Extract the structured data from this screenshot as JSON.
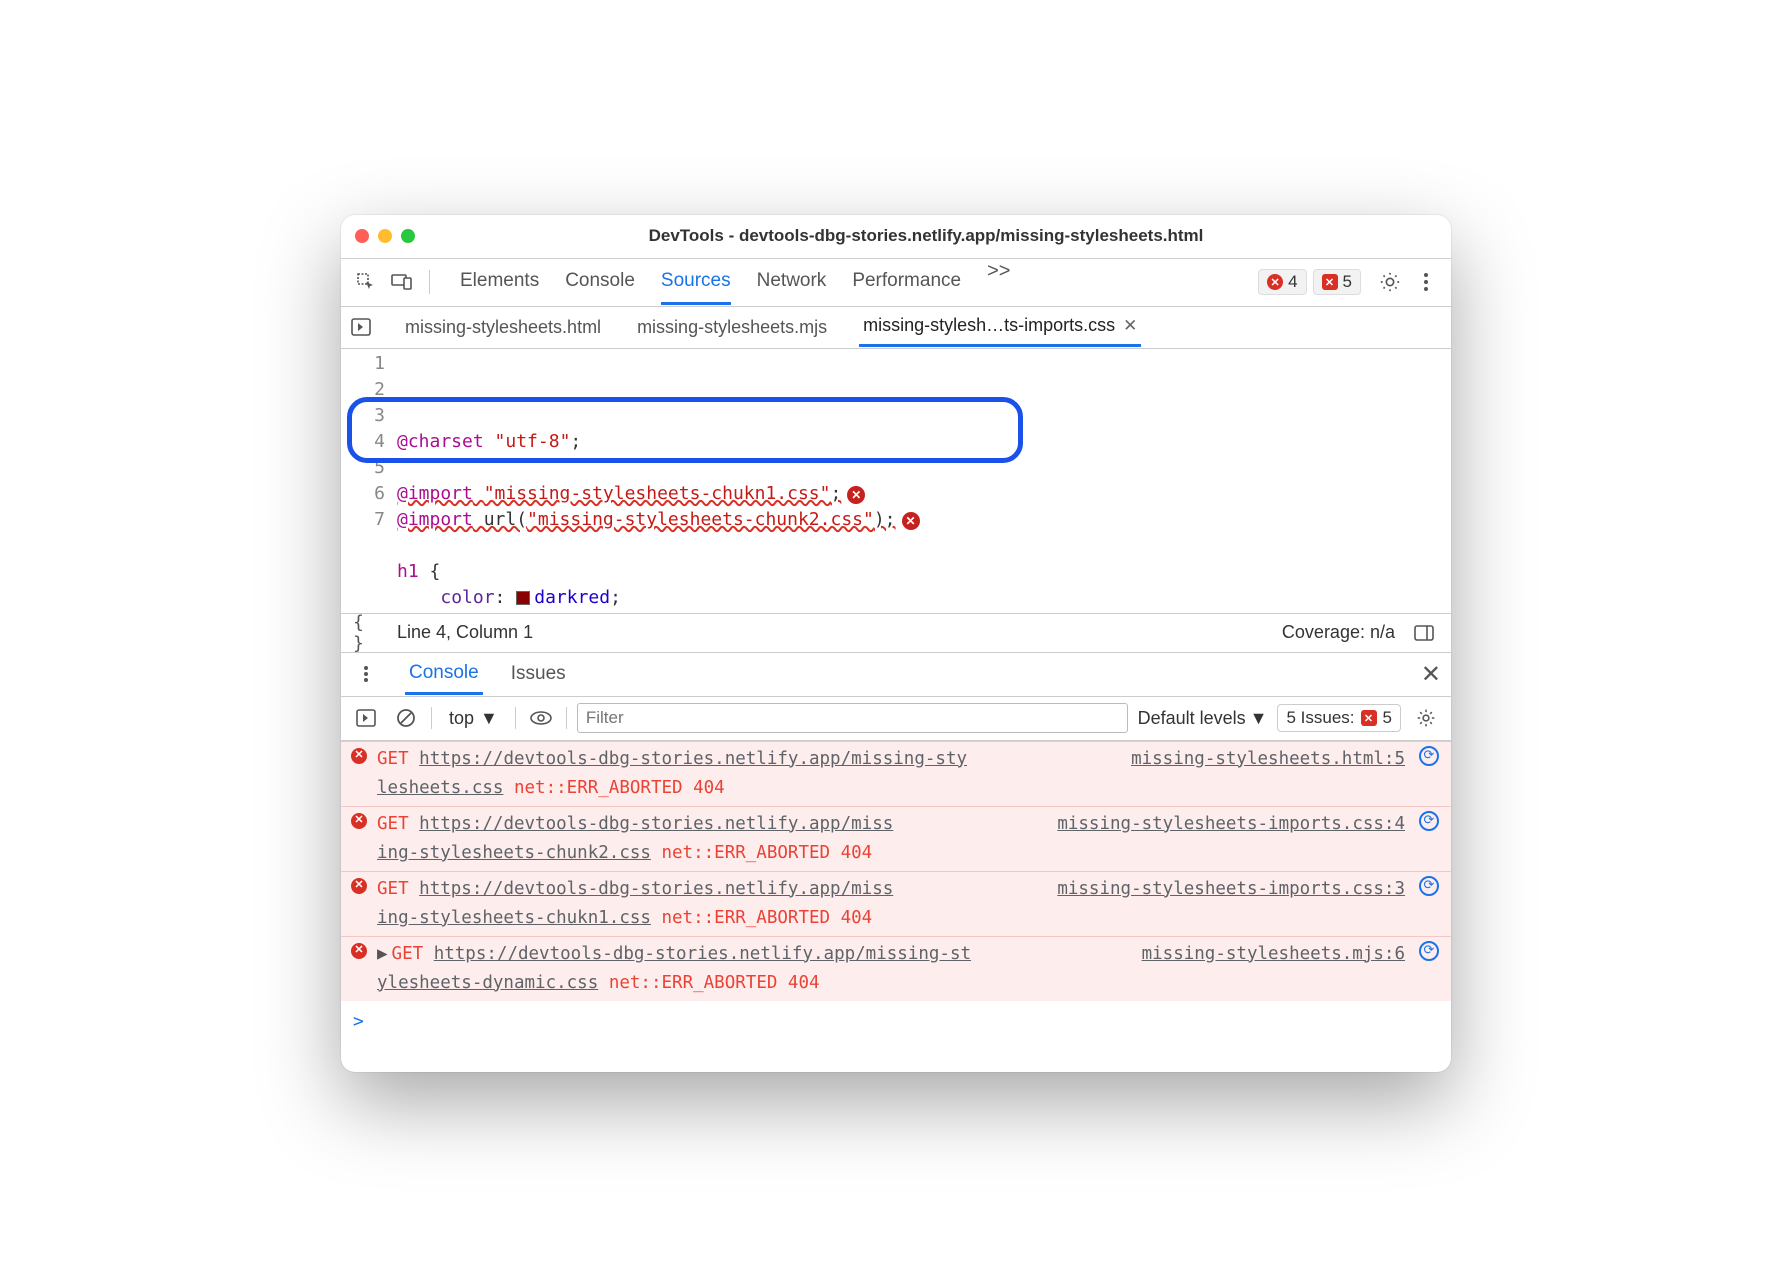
{
  "window": {
    "title": "DevTools - devtools-dbg-stories.netlify.app/missing-stylesheets.html"
  },
  "panels": {
    "items": [
      "Elements",
      "Console",
      "Sources",
      "Network",
      "Performance"
    ],
    "active": "Sources",
    "more": ">>"
  },
  "error_badges": {
    "round": "4",
    "square": "5"
  },
  "file_tabs": {
    "items": [
      {
        "label": "missing-stylesheets.html",
        "active": false
      },
      {
        "label": "missing-stylesheets.mjs",
        "active": false
      },
      {
        "label": "missing-stylesh…ts-imports.css",
        "active": true
      }
    ]
  },
  "editor": {
    "lines": [
      {
        "n": "1",
        "html": "<span class='k-at'>@charset</span> <span class='k-str'>\"utf-8\"</span>;"
      },
      {
        "n": "2",
        "html": ""
      },
      {
        "n": "3",
        "html": "<span class='k-at wavy'>@import</span><span class='wavy'> </span><span class='k-str wavy'>\"missing-stylesheets-chukn1.css\"</span><span class='wavy'>;</span><span class='inline-err'>✕</span>"
      },
      {
        "n": "4",
        "html": "<span class='k-at wavy'>@import</span><span class='wavy'> url(</span><span class='k-str wavy'>\"missing-stylesheets-chunk2.css\"</span><span class='wavy'>);</span><span class='inline-err'>✕</span>"
      },
      {
        "n": "5",
        "html": ""
      },
      {
        "n": "6",
        "html": "<span class='k-sel'>h1</span> {"
      },
      {
        "n": "7",
        "html": "    <span class='k-prop'>color</span>: <span class='swatch'></span><span class='k-val'>darkred</span>;"
      }
    ]
  },
  "status": {
    "cursor": "Line 4, Column 1",
    "coverage": "Coverage: n/a"
  },
  "drawer": {
    "tabs": [
      "Console",
      "Issues"
    ],
    "active": "Console"
  },
  "console_toolbar": {
    "context": "top",
    "filter_placeholder": "Filter",
    "levels": "Default levels",
    "issues_label": "5 Issues:",
    "issues_count": "5"
  },
  "console": [
    {
      "method": "GET",
      "url1": "https://devtools-dbg-stories.netlify.app/missing-sty",
      "url2": "lesheets.css",
      "err": "net::ERR_ABORTED 404",
      "src": "missing-stylesheets.html:5",
      "expandable": false
    },
    {
      "method": "GET",
      "url1": "https://devtools-dbg-stories.netlify.app/miss",
      "url2": "ing-stylesheets-chunk2.css",
      "err": "net::ERR_ABORTED 404",
      "src": "missing-stylesheets-imports.css:4",
      "expandable": false,
      "hl": true
    },
    {
      "method": "GET",
      "url1": "https://devtools-dbg-stories.netlify.app/miss",
      "url2": "ing-stylesheets-chukn1.css",
      "err": "net::ERR_ABORTED 404",
      "src": "missing-stylesheets-imports.css:3",
      "expandable": false,
      "hl": true
    },
    {
      "method": "GET",
      "url1": "https://devtools-dbg-stories.netlify.app/missing-st",
      "url2": "ylesheets-dynamic.css",
      "err": "net::ERR_ABORTED 404",
      "src": "missing-stylesheets.mjs:6",
      "expandable": true
    }
  ]
}
